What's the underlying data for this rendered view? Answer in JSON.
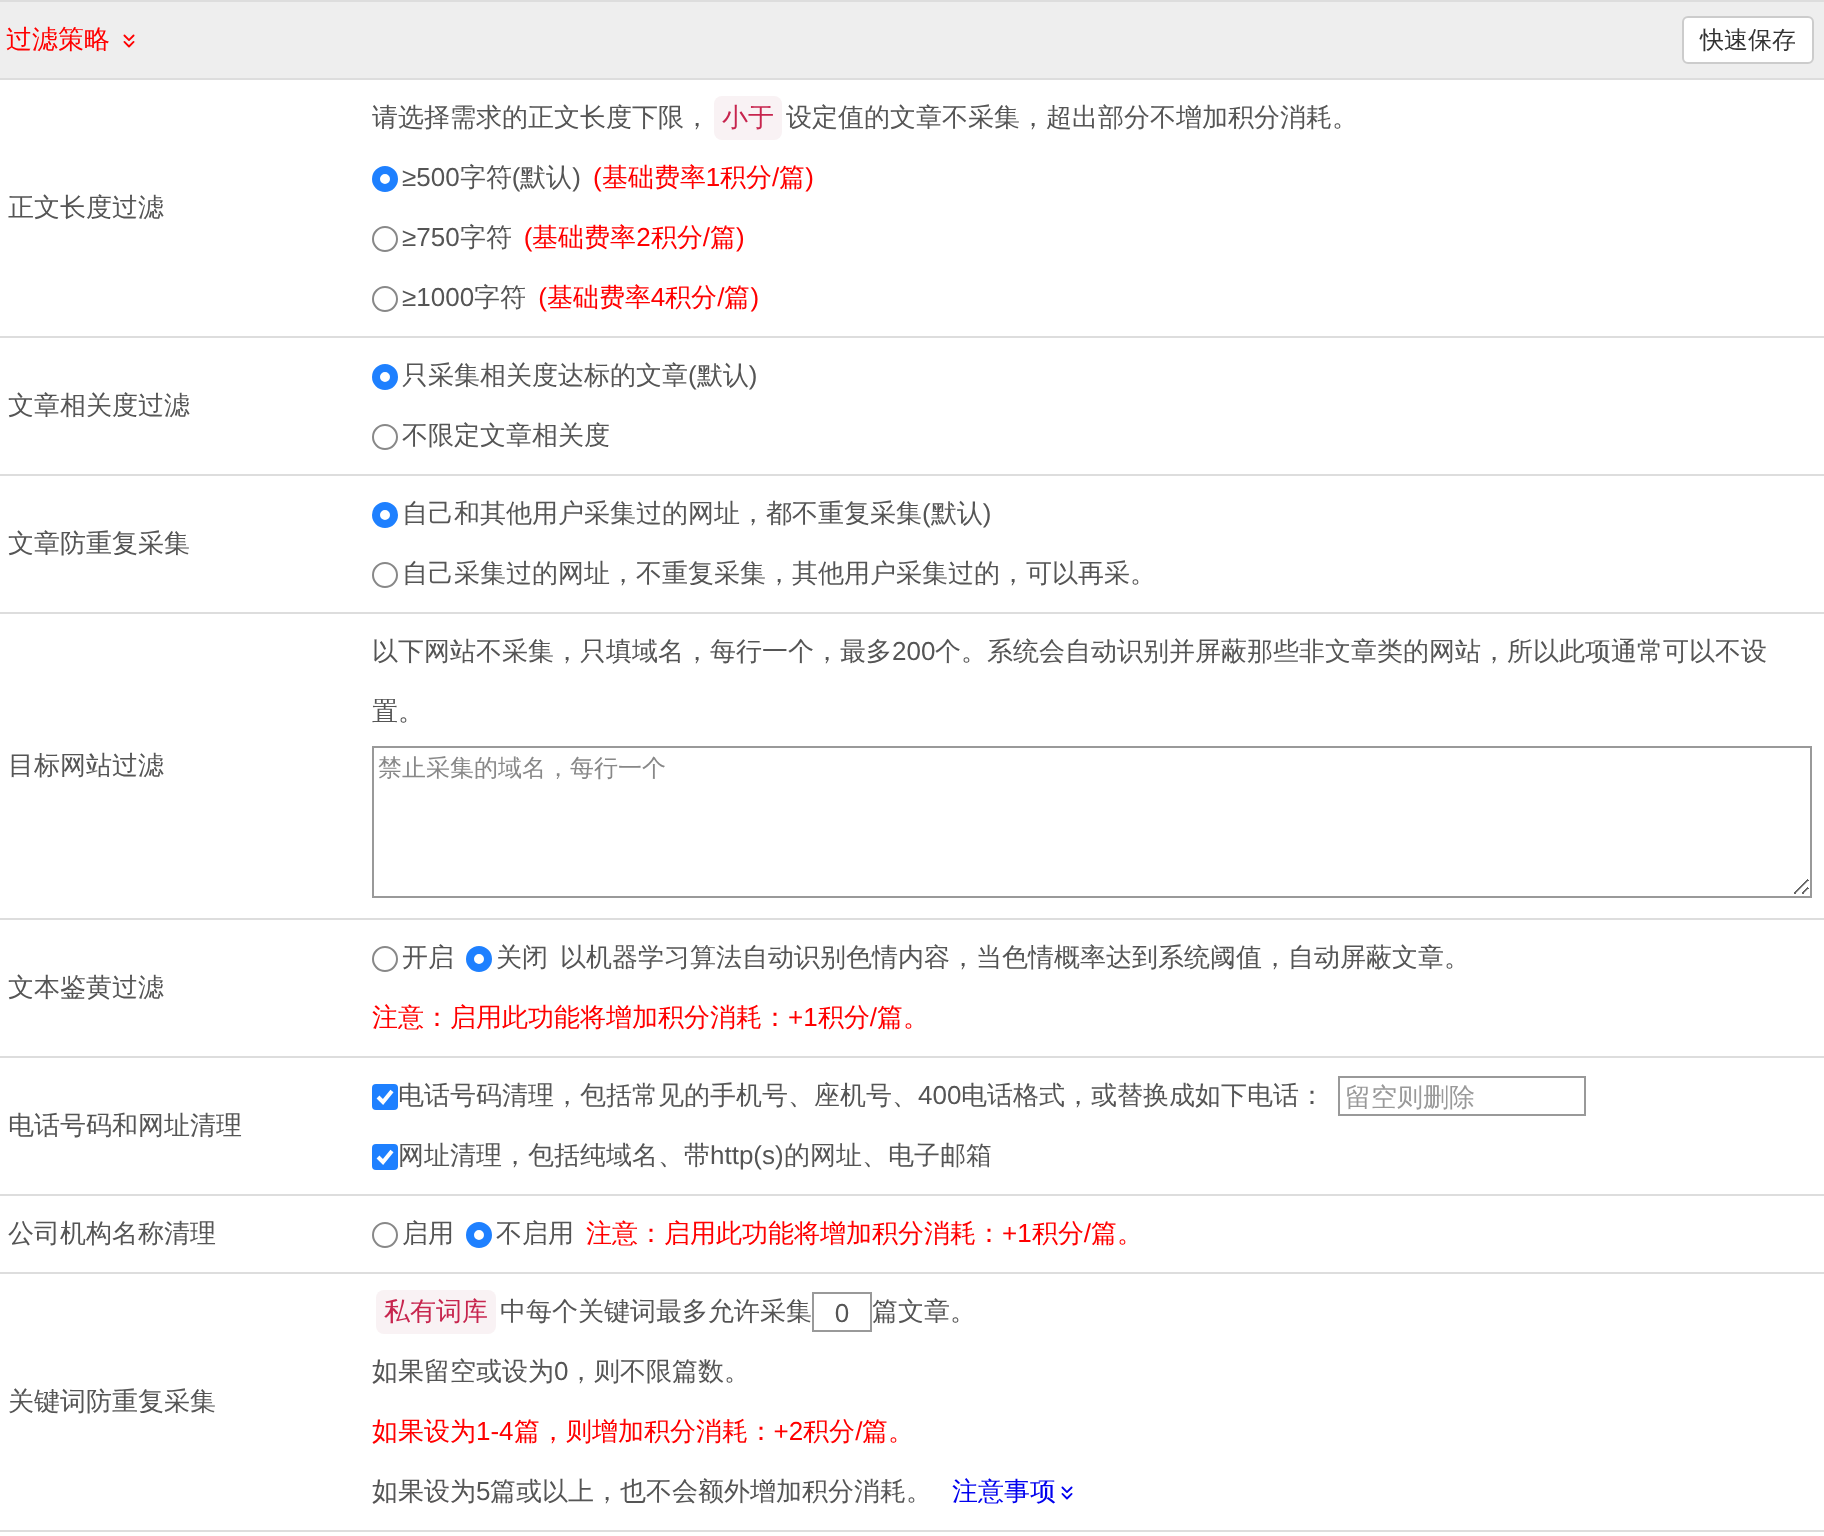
{
  "header": {
    "title": "过滤策略",
    "button": "快速保存"
  },
  "rows": [
    {
      "label": "正文长度过滤",
      "lines": [
        [
          {
            "kind": "text",
            "text": "请选择需求的正文长度下限，"
          },
          {
            "kind": "tag",
            "text": "小于"
          },
          {
            "kind": "text",
            "text": "设定值的文章不采集，超出部分不增加积分消耗。"
          }
        ],
        [
          {
            "kind": "radio",
            "label": "≥500字符(默认)",
            "selected": true
          },
          {
            "kind": "warn",
            "text": "(基础费率1积分/篇)"
          }
        ],
        [
          {
            "kind": "radio",
            "label": "≥750字符",
            "selected": false
          },
          {
            "kind": "warn",
            "text": "(基础费率2积分/篇)"
          }
        ],
        [
          {
            "kind": "radio",
            "label": "≥1000字符",
            "selected": false
          },
          {
            "kind": "warn",
            "text": "(基础费率4积分/篇)"
          }
        ]
      ]
    },
    {
      "label": "文章相关度过滤",
      "lines": [
        [
          {
            "kind": "radio",
            "label": "只采集相关度达标的文章(默认)",
            "selected": true
          }
        ],
        [
          {
            "kind": "radio",
            "label": "不限定文章相关度",
            "selected": false
          }
        ]
      ]
    },
    {
      "label": "文章防重复采集",
      "lines": [
        [
          {
            "kind": "radio",
            "label": "自己和其他用户采集过的网址，都不重复采集(默认)",
            "selected": true
          }
        ],
        [
          {
            "kind": "radio",
            "label": "自己采集过的网址，不重复采集，其他用户采集过的，可以再采。",
            "selected": false
          }
        ]
      ]
    },
    {
      "label": "目标网站过滤",
      "lines": [
        [
          {
            "kind": "text",
            "text": "以下网站不采集，只填域名，每行一个，最多200个。系统会自动识别并屏蔽那些非文章类的网站，所以此项通常可以不设置。"
          }
        ],
        [
          {
            "kind": "textarea",
            "placeholder": "禁止采集的域名，每行一个"
          }
        ]
      ]
    },
    {
      "label": "文本鉴黄过滤",
      "lines": [
        [
          {
            "kind": "radio",
            "label": "开启",
            "selected": false
          },
          {
            "kind": "radio",
            "label": "关闭",
            "selected": true
          },
          {
            "kind": "text",
            "text": "以机器学习算法自动识别色情内容，当色情概率达到系统阈值，自动屏蔽文章。"
          }
        ],
        [
          {
            "kind": "warn",
            "text": "注意：启用此功能将增加积分消耗：+1积分/篇。"
          }
        ]
      ]
    },
    {
      "label": "电话号码和网址清理",
      "lines": [
        [
          {
            "kind": "checkbox",
            "label": "电话号码清理，包括常见的手机号、座机号、400电话格式，或替换成如下电话：",
            "checked": true
          },
          {
            "kind": "input",
            "placeholder": "留空则删除"
          }
        ],
        [
          {
            "kind": "checkbox",
            "label": "网址清理，包括纯域名、带http(s)的网址、电子邮箱",
            "checked": true
          }
        ]
      ]
    },
    {
      "label": "公司机构名称清理",
      "lines": [
        [
          {
            "kind": "radio",
            "label": "启用",
            "selected": false
          },
          {
            "kind": "radio",
            "label": "不启用",
            "selected": true
          },
          {
            "kind": "warn",
            "text": "注意：启用此功能将增加积分消耗：+1积分/篇。"
          }
        ]
      ]
    },
    {
      "label": "关键词防重复采集",
      "lines": [
        [
          {
            "kind": "tag",
            "text": "私有词库"
          },
          {
            "kind": "text",
            "text": "中每个关键词最多允许采集"
          },
          {
            "kind": "number",
            "value": "0"
          },
          {
            "kind": "text",
            "text": "篇文章。"
          }
        ],
        [
          {
            "kind": "text",
            "text": "如果留空或设为0，则不限篇数。"
          }
        ],
        [
          {
            "kind": "warn",
            "text": "如果设为1-4篇，则增加积分消耗：+2积分/篇。"
          }
        ],
        [
          {
            "kind": "text",
            "text": "如果设为5篇或以上，也不会额外增加积分消耗。"
          },
          {
            "kind": "link",
            "text": "注意事项"
          }
        ]
      ]
    }
  ]
}
